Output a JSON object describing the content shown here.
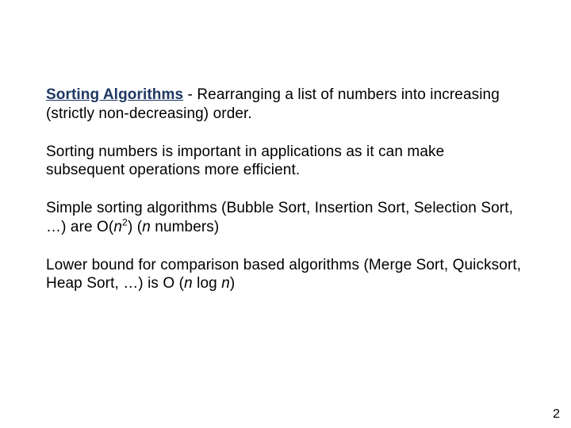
{
  "para1": {
    "heading": "Sorting Algorithms",
    "rest": " - Rearranging a list of numbers into increasing (strictly non-decreasing) order."
  },
  "para2": "Sorting numbers is important in applications as it can make subsequent operations more efficient.",
  "para3": {
    "prefix": "Simple sorting algorithms (Bubble Sort, Insertion Sort, Selection Sort, …) are O(",
    "n": "n",
    "exp": "2",
    "mid": ")  (",
    "n2": "n",
    "suffix": " numbers)"
  },
  "para4": {
    "prefix": "Lower bound for comparison based algorithms (Merge Sort, Quicksort, Heap Sort, …) is O (",
    "n1": "n",
    "log": " log ",
    "n2": "n",
    "suffix": ")"
  },
  "page_number": "2"
}
